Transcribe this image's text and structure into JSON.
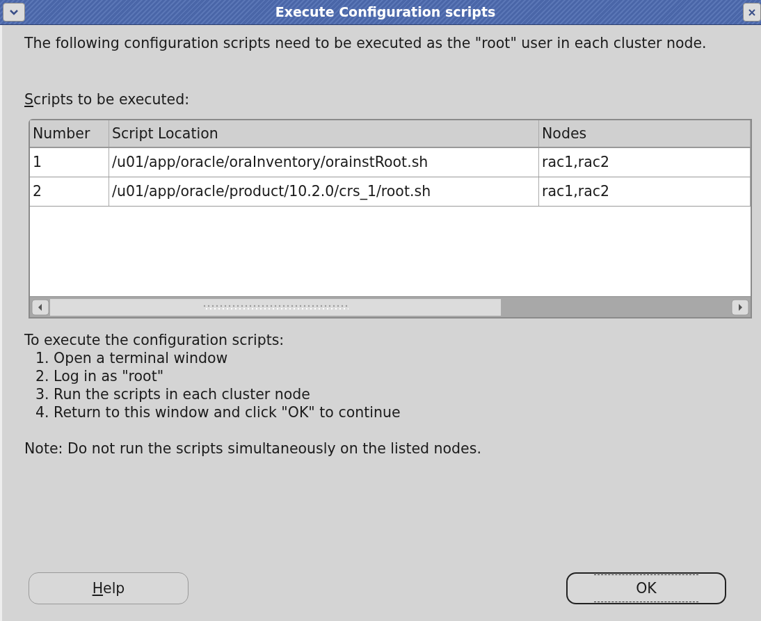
{
  "window": {
    "title": "Execute Configuration scripts"
  },
  "intro": "The following configuration scripts need to be executed as the \"root\" user in each cluster node.",
  "table_label": {
    "text": "Scripts to be executed:",
    "mnemonic": true
  },
  "table": {
    "columns": [
      "Number",
      "Script Location",
      "Nodes"
    ],
    "rows": [
      [
        "1",
        "/u01/app/oracle/oraInventory/orainstRoot.sh",
        "rac1,rac2"
      ],
      [
        "2",
        "/u01/app/oracle/product/10.2.0/crs_1/root.sh",
        "rac1,rac2"
      ]
    ]
  },
  "instructions_title": "To execute the configuration scripts:",
  "steps": [
    "1. Open a terminal window",
    "2. Log in as \"root\"",
    "3. Run the scripts in each cluster node",
    "4. Return to this window and click \"OK\" to continue"
  ],
  "note": "Note: Do not run the scripts simultaneously on the listed nodes.",
  "buttons": [
    {
      "label": "Help",
      "mnemonic": true,
      "focused": false
    },
    {
      "label": "OK",
      "focused": true
    }
  ]
}
